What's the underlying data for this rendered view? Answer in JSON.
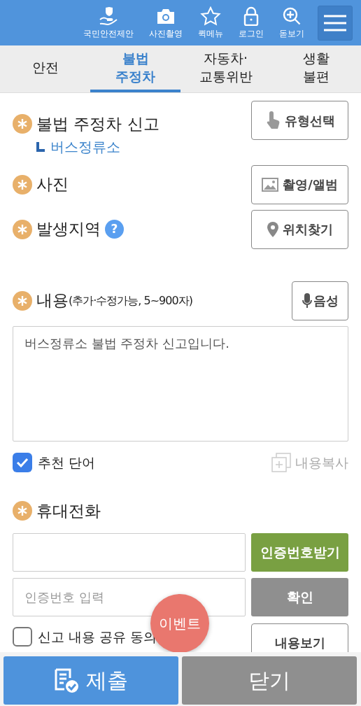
{
  "header": {
    "menu_items": [
      {
        "label": "국민안전제안"
      },
      {
        "label": "사진촬영"
      },
      {
        "label": "퀵메뉴"
      },
      {
        "label": "로그인"
      },
      {
        "label": "돋보기"
      }
    ]
  },
  "tabs": [
    {
      "label": "안전",
      "selected": false
    },
    {
      "label": "불법\n주정차",
      "selected": true
    },
    {
      "label": "자동차·\n교통위반",
      "selected": false
    },
    {
      "label": "생활\n불편",
      "selected": false
    }
  ],
  "report_type": {
    "label": "불법 주정차 신고",
    "required": true,
    "sub_label": "버스정류소",
    "button": "유형선택"
  },
  "photo": {
    "label": "사진",
    "required": true,
    "button": "촬영/앨범"
  },
  "location": {
    "label": "발생지역",
    "required": true,
    "help": "?",
    "button": "위치찾기"
  },
  "content": {
    "label": "내용",
    "hint": "(추가·수정가능, 5~900자)",
    "required": true,
    "button": "음성",
    "value": "버스정류소 불법 주정차 신고입니다.",
    "recommend": {
      "label": "추천 단어",
      "checked": true
    },
    "copy_button": "내용복사",
    "copy_disabled": true
  },
  "phone": {
    "label": "휴대전화",
    "required": true,
    "request_button": "인증번호받기",
    "code_placeholder": "인증번호 입력",
    "confirm_button": "확인",
    "consent": {
      "label": "신고 내용 공유 동의",
      "checked": false
    },
    "view_button": "내용보기"
  },
  "event_badge": "이벤트",
  "footer": {
    "submit": "제출",
    "close": "닫기"
  }
}
